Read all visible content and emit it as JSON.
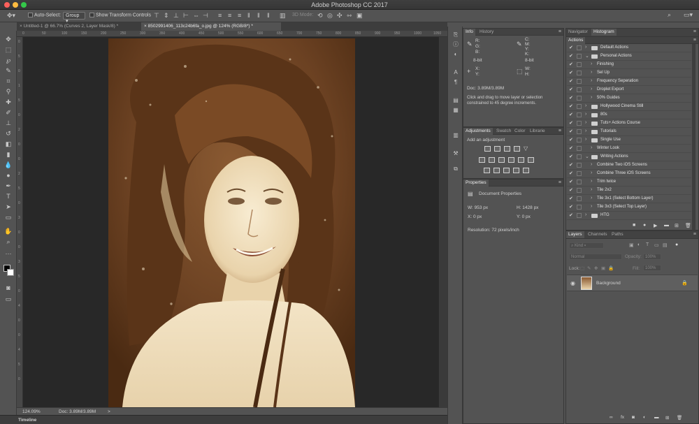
{
  "window": {
    "title": "Adobe Photoshop CC 2017"
  },
  "options_bar": {
    "auto_select_label": "Auto-Select:",
    "auto_select_value": "Group",
    "transform_controls_label": "Show Transform Controls",
    "mode_3d_label": "3D Mode:"
  },
  "tabs": [
    {
      "label": "Untitled-1 @ 66.7% (Curves 2, Layer Mask/8) *",
      "active": false
    },
    {
      "label": "8502991406_113c24b6fa_o.jpg @ 124% (RGB/8*) *",
      "active": true
    }
  ],
  "ruler_h": [
    "0",
    "50",
    "100",
    "150",
    "200",
    "250",
    "300",
    "350",
    "400",
    "450",
    "500",
    "550",
    "600",
    "650",
    "700",
    "750",
    "800",
    "850",
    "900",
    "950",
    "1000",
    "1050"
  ],
  "ruler_v": [
    "0",
    "5",
    "0",
    "1",
    "5",
    "0",
    "2",
    "0",
    "0",
    "2",
    "5",
    "0",
    "3",
    "0",
    "0",
    "3",
    "5",
    "0",
    "4",
    "0",
    "0",
    "4",
    "5",
    "0"
  ],
  "status": {
    "zoom": "124.09%",
    "doc": "Doc: 3.89M/3.89M",
    "arrow": ">"
  },
  "timeline": {
    "label": "Timeline"
  },
  "info_panel": {
    "tabs": [
      "Info",
      "History"
    ],
    "r_label": "R:",
    "g_label": "G:",
    "b_label": "B:",
    "c_label": "C:",
    "m_label": "M:",
    "y_label": "Y:",
    "k_label": "K:",
    "bit_left": "8-bit",
    "bit_right": "8-bit",
    "x_label": "X:",
    "y2_label": "Y:",
    "w_label": "W:",
    "h_label": "H:",
    "doc": "Doc: 3.89M/3.89M",
    "hint_line1": "Click and drag to move layer or selection",
    "hint_line2": "constrained to 45 degree increments."
  },
  "adjustments_panel": {
    "tabs": [
      "Adjustments",
      "Swatch",
      "Color",
      "Librarie"
    ],
    "header": "Add an adjustment"
  },
  "properties_panel": {
    "tab": "Properties",
    "title": "Document Properties",
    "w": "W: 953 px",
    "h": "H: 1428 px",
    "x": "X: 0 px",
    "y": "Y: 0 px",
    "resolution": "Resolution: 72 pixels/inch"
  },
  "right_top_tabs": [
    "Navigator",
    "Histogram"
  ],
  "actions_panel": {
    "tab": "Actions",
    "rows": [
      {
        "label": "Default Actions",
        "type": "set",
        "indent": 0,
        "expanded": false
      },
      {
        "label": "Personal Actions",
        "type": "set",
        "indent": 0,
        "expanded": true
      },
      {
        "label": "Finishing",
        "type": "action",
        "indent": 1,
        "expanded": false
      },
      {
        "label": "Sel Up",
        "type": "action",
        "indent": 1,
        "expanded": false
      },
      {
        "label": "Frequency Seperation",
        "type": "action",
        "indent": 1,
        "expanded": false
      },
      {
        "label": "Droplet Export",
        "type": "action",
        "indent": 1,
        "expanded": false
      },
      {
        "label": "50% Guides",
        "type": "action",
        "indent": 1,
        "expanded": false
      },
      {
        "label": "Hollywood Cinema Still",
        "type": "set",
        "indent": 0,
        "expanded": false
      },
      {
        "label": "80s",
        "type": "set",
        "indent": 0,
        "expanded": false
      },
      {
        "label": "Tuts+ Actions Course",
        "type": "set",
        "indent": 0,
        "expanded": false
      },
      {
        "label": "Tutorials",
        "type": "set",
        "indent": 0,
        "expanded": false
      },
      {
        "label": "Single Use",
        "type": "set",
        "indent": 0,
        "expanded": false
      },
      {
        "label": "Winter Look",
        "type": "action",
        "indent": 1,
        "expanded": false
      },
      {
        "label": "Writing Actions",
        "type": "set",
        "indent": 0,
        "expanded": true
      },
      {
        "label": "Combine Two iOS Screens",
        "type": "action",
        "indent": 1,
        "expanded": false
      },
      {
        "label": "Combine Three iOS Screens",
        "type": "action",
        "indent": 1,
        "expanded": false
      },
      {
        "label": "Trim twice",
        "type": "action",
        "indent": 1,
        "expanded": false
      },
      {
        "label": "Tile 2x2",
        "type": "action",
        "indent": 1,
        "expanded": false
      },
      {
        "label": "Tile 3x1 (Select Bottom Layer)",
        "type": "action",
        "indent": 1,
        "expanded": false
      },
      {
        "label": "Tile 3x3 (Select Top Layer)",
        "type": "action",
        "indent": 1,
        "expanded": false
      },
      {
        "label": "HTG",
        "type": "set",
        "indent": 0,
        "expanded": false
      }
    ]
  },
  "layers_panel": {
    "tabs": [
      "Layers",
      "Channels",
      "Paths"
    ],
    "kind_label": "Kind",
    "blend_mode": "Normal",
    "opacity_label": "Opacity:",
    "opacity_value": "100%",
    "lock_label": "Lock:",
    "fill_label": "Fill:",
    "fill_value": "100%",
    "layers": [
      {
        "name": "Background",
        "locked": true,
        "visible": true
      }
    ],
    "footer_icons": [
      "link-icon",
      "fx-icon",
      "mask-icon",
      "adjustment-icon",
      "folder-icon",
      "new-layer-icon",
      "trash-icon"
    ]
  },
  "colors": {
    "ui_bg": "#535353",
    "canvas_bg": "#282828",
    "sepia_light": "#f0e2c4",
    "sepia_dark": "#4a2a12"
  }
}
